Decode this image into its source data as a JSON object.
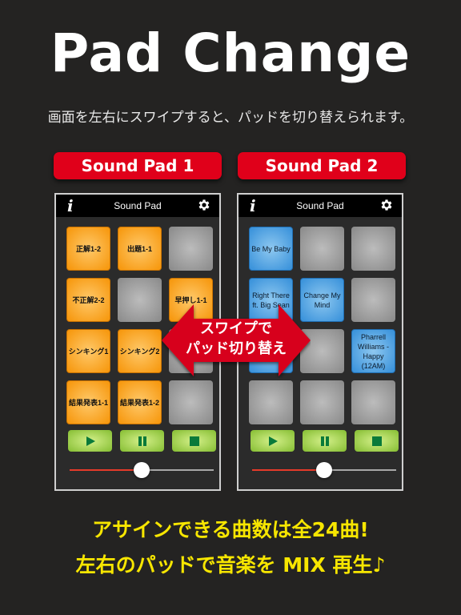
{
  "header": {
    "title": "Pad Change",
    "subtitle": "画面を左右にスワイプすると、パッドを切り替えられます。"
  },
  "panels": [
    {
      "label": "Sound Pad 1",
      "nav_title": "Sound Pad",
      "pads": [
        {
          "text": "正解1-2",
          "color": "orange"
        },
        {
          "text": "出題1-1",
          "color": "orange"
        },
        {
          "text": "",
          "color": "empty"
        },
        {
          "text": "不正解2-2",
          "color": "orange"
        },
        {
          "text": "",
          "color": "empty"
        },
        {
          "text": "早押し1-1",
          "color": "orange"
        },
        {
          "text": "シンキング1",
          "color": "orange"
        },
        {
          "text": "シンキング2",
          "color": "orange"
        },
        {
          "text": "",
          "color": "empty"
        },
        {
          "text": "結果発表1-1",
          "color": "orange"
        },
        {
          "text": "結果発表1-2",
          "color": "orange"
        },
        {
          "text": "",
          "color": "empty"
        }
      ],
      "slider_value_percent": 50
    },
    {
      "label": "Sound Pad 2",
      "nav_title": "Sound Pad",
      "pads": [
        {
          "text": "Be My Baby",
          "color": "blue"
        },
        {
          "text": "",
          "color": "empty"
        },
        {
          "text": "",
          "color": "empty"
        },
        {
          "text": "Right There ft. Big Sean",
          "color": "blue"
        },
        {
          "text": "Change My Mind",
          "color": "blue"
        },
        {
          "text": "",
          "color": "empty"
        },
        {
          "text": "",
          "color": "blue"
        },
        {
          "text": "",
          "color": "empty"
        },
        {
          "text": "Pharrell Williams - Happy (12AM)",
          "color": "blue"
        },
        {
          "text": "",
          "color": "empty"
        },
        {
          "text": "",
          "color": "empty"
        },
        {
          "text": "",
          "color": "empty"
        }
      ],
      "slider_value_percent": 50
    }
  ],
  "controls": {
    "play_icon": "play-icon",
    "pause_icon": "pause-icon",
    "stop_icon": "stop-icon"
  },
  "swipe_callout": {
    "line1": "スワイプで",
    "line2": "パッド切り替え"
  },
  "footer": {
    "line1": "アサインできる曲数は全24曲!",
    "line2": "左右のパッドで音楽を MIX 再生♪"
  },
  "colors": {
    "accent_red": "#e0001a",
    "pad_orange": "#f79a12",
    "pad_blue": "#3e95dc",
    "control_green": "#8cc23a",
    "footer_yellow": "#f7e600"
  }
}
